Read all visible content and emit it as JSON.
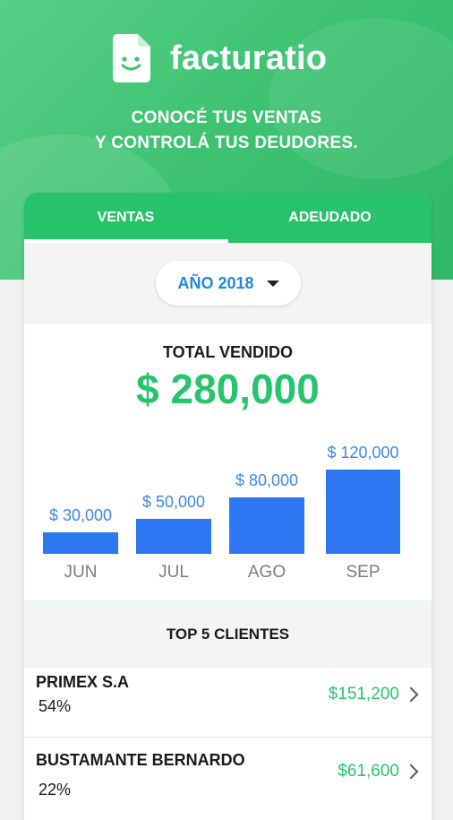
{
  "app": {
    "name": "facturatio",
    "tagline_line1": "CONOCÉ TUS VENTAS",
    "tagline_line2": "Y CONTROLÁ TUS DEUDORES."
  },
  "tabs": [
    {
      "label": "VENTAS",
      "active": true
    },
    {
      "label": "ADEUDADO",
      "active": false
    }
  ],
  "year_selector": {
    "value": "AÑO 2018"
  },
  "total": {
    "title": "TOTAL VENDIDO",
    "value": "$ 280,000"
  },
  "chart_data": {
    "type": "bar",
    "categories": [
      "JUN",
      "JUL",
      "AGO",
      "SEP"
    ],
    "values": [
      30000,
      50000,
      80000,
      120000
    ],
    "value_labels": [
      "$ 30,000",
      "$ 50,000",
      "$ 80,000",
      "$ 120,000"
    ],
    "title": "",
    "xlabel": "",
    "ylabel": "",
    "bar_color": "#2d78f0",
    "label_color": "#3f86ea"
  },
  "top_clients": {
    "title": "TOP 5 CLIENTES",
    "items": [
      {
        "name": "PRIMEX S.A",
        "percent": "54%",
        "amount": "$151,200"
      },
      {
        "name": "BUSTAMANTE BERNARDO",
        "percent": "22%",
        "amount": "$61,600"
      }
    ]
  },
  "colors": {
    "brand_green": "#28c46d",
    "accent_blue": "#1f88e5"
  },
  "icons": {
    "logo": "smiling-document-icon",
    "dropdown": "caret-down-icon",
    "row_arrow": "chevron-right-icon"
  }
}
